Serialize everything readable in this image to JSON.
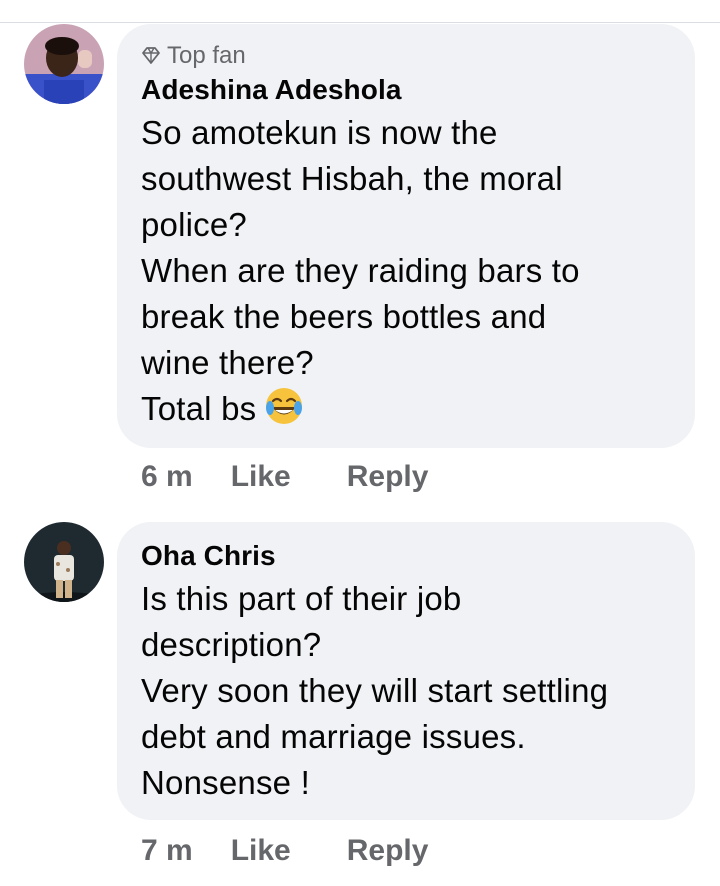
{
  "comments": [
    {
      "badge": "Top fan",
      "author": "Adeshina Adeshola",
      "lines": [
        "So amotekun is now the",
        "southwest Hisbah, the moral",
        "police?",
        "When are they raiding bars to",
        "break  the beers bottles and",
        "wine there?",
        "Total bs"
      ],
      "emoji": "laughing-tears-emoji",
      "time": "6 m",
      "like_label": "Like",
      "reply_label": "Reply"
    },
    {
      "author": "Oha Chris",
      "lines": [
        "Is this part of their job",
        "description?",
        "Very soon they will start settling",
        "debt and marriage issues.",
        "Nonsense !"
      ],
      "time": "7 m",
      "like_label": "Like",
      "reply_label": "Reply"
    }
  ],
  "colors": {
    "bubble": "#f0f2f5",
    "text": "#050505",
    "secondary": "#65676b"
  }
}
